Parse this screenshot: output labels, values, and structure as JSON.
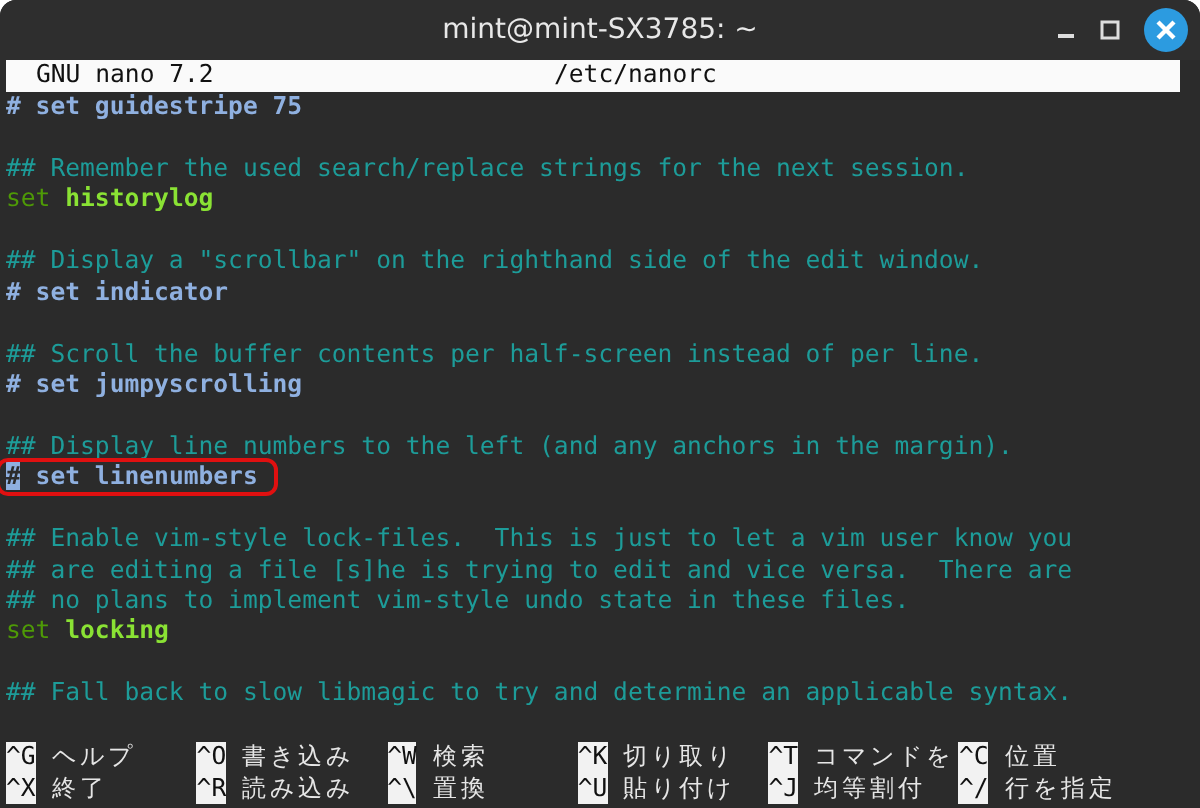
{
  "window": {
    "title": "mint@mint-SX3785: ~"
  },
  "header": {
    "program": "GNU nano 7.2",
    "file": "/etc/nanorc"
  },
  "lines": [
    {
      "kind": "disabled",
      "text": "# set guidestripe 75"
    },
    {
      "kind": "blank"
    },
    {
      "kind": "comment",
      "text": "## Remember the used search/replace strings for the next session."
    },
    {
      "kind": "setting",
      "text": "set **historylog**"
    },
    {
      "kind": "blank"
    },
    {
      "kind": "comment",
      "text": "## Display a \"scrollbar\" on the righthand side of the edit window."
    },
    {
      "kind": "disabled",
      "text": "# set indicator"
    },
    {
      "kind": "blank"
    },
    {
      "kind": "comment",
      "text": "## Scroll the buffer contents per half-screen instead of per line."
    },
    {
      "kind": "disabled",
      "text": "# set jumpyscrolling"
    },
    {
      "kind": "blank"
    },
    {
      "kind": "comment",
      "text": "## Display line numbers to the left (and any anchors in the margin)."
    },
    {
      "kind": "disabled",
      "text": "# set linenumbers",
      "cursor": true,
      "highlighted": true
    },
    {
      "kind": "blank"
    },
    {
      "kind": "comment",
      "text": "## Enable vim-style lock-files.  This is just to let a vim user know you"
    },
    {
      "kind": "comment",
      "text": "## are editing a file [s]he is trying to edit and vice versa.  There are"
    },
    {
      "kind": "comment",
      "text": "## no plans to implement vim-style undo state in these files."
    },
    {
      "kind": "setting",
      "text": "set **locking**"
    },
    {
      "kind": "blank"
    },
    {
      "kind": "comment",
      "text": "## Fall back to slow libmagic to try and determine an applicable syntax."
    },
    {
      "kind": "blank"
    }
  ],
  "shortcuts": [
    {
      "key": "^G",
      "label": "ヘルプ"
    },
    {
      "key": "^O",
      "label": "書き込み"
    },
    {
      "key": "^W",
      "label": "検索"
    },
    {
      "key": "^K",
      "label": "切り取り"
    },
    {
      "key": "^T",
      "label": "コマンドを"
    },
    {
      "key": "^C",
      "label": "位置"
    },
    {
      "key": "^X",
      "label": "終了"
    },
    {
      "key": "^R",
      "label": "読み込み"
    },
    {
      "key": "^\\",
      "label": "置換"
    },
    {
      "key": "^U",
      "label": "貼り付け"
    },
    {
      "key": "^J",
      "label": "均等割付"
    },
    {
      "key": "^/",
      "label": "行を指定"
    }
  ]
}
